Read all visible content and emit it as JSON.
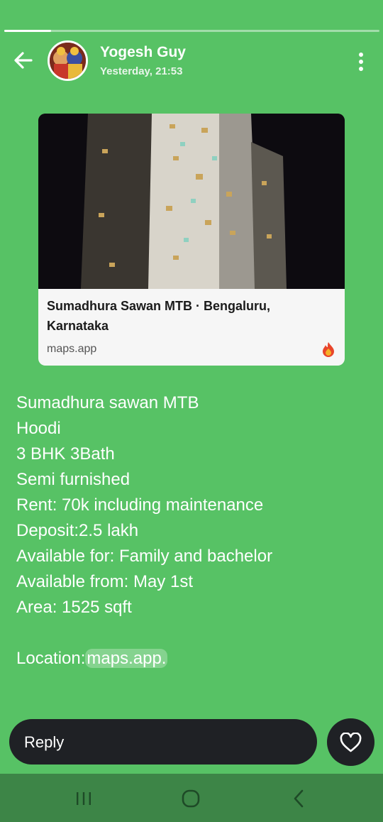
{
  "story": {
    "progress_fraction": 0.125
  },
  "header": {
    "sender_name": "Yogesh Guy",
    "timestamp": "Yesterday, 21:53",
    "back_icon": "arrow-left-icon",
    "more_icon": "more-vertical-icon"
  },
  "link_preview": {
    "title": "Sumadhura Sawan MTB · Bengaluru, Karnataka",
    "domain": "maps.app",
    "source_icon": "fire-icon",
    "image_description_icon": "building-photo"
  },
  "message": {
    "lines": [
      "Sumadhura sawan MTB",
      "Hoodi",
      "3 BHK 3Bath",
      "Semi furnished",
      "Rent: 70k including maintenance",
      "Deposit:2.5 lakh",
      "Available for: Family and bachelor",
      "Available from: May 1st",
      "Area: 1525 sqft"
    ],
    "location_label": "Location:",
    "location_link": "maps.app."
  },
  "reply": {
    "label": "Reply",
    "like_icon": "heart-icon"
  },
  "navigation": {
    "recent_icon": "recent-apps-icon",
    "home_icon": "home-icon",
    "back_icon": "nav-back-icon"
  },
  "colors": {
    "background": "#57c265",
    "bar": "#1f2125",
    "navbar": "#3d8547"
  }
}
